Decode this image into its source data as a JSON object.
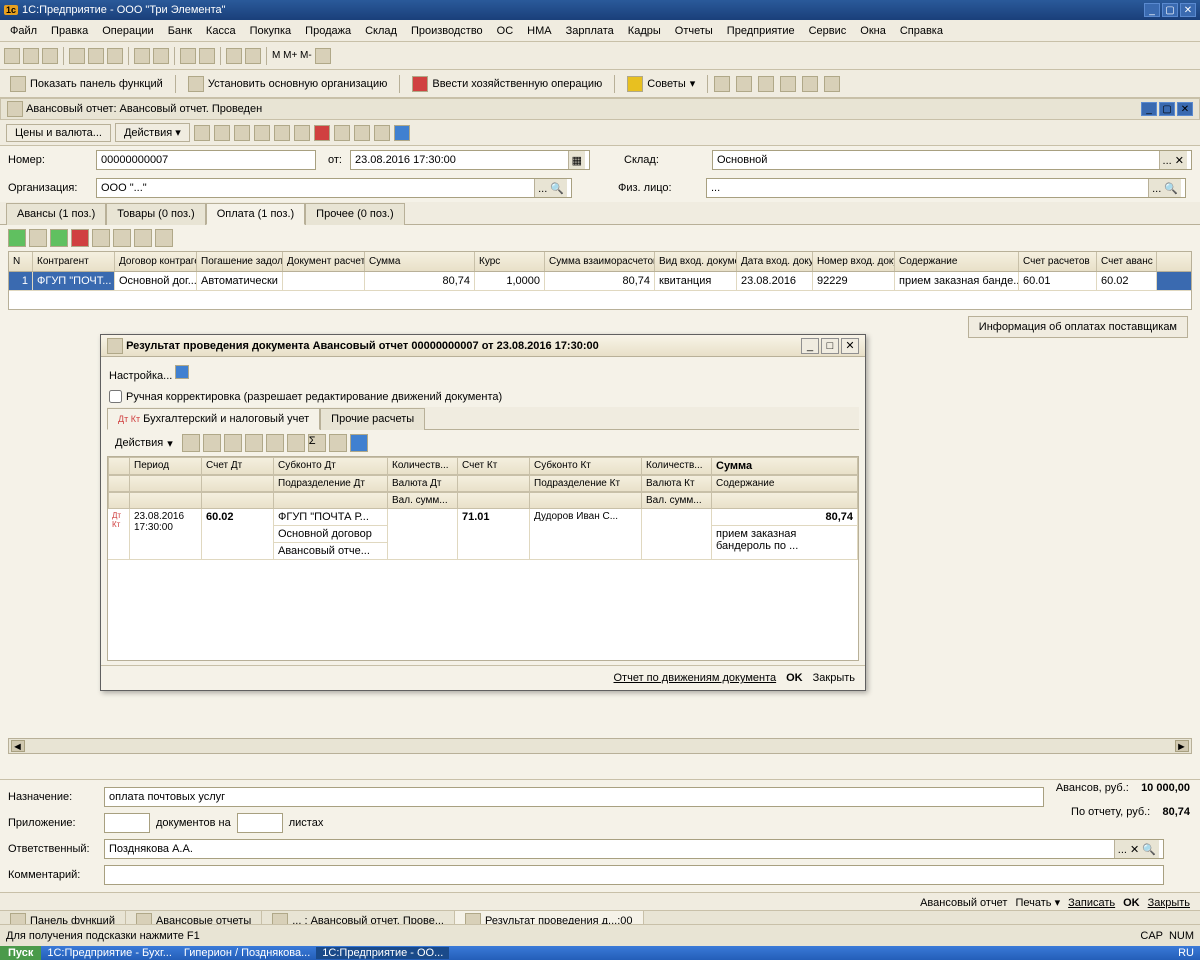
{
  "app": {
    "title": "1С:Предприятие - ООО \"Три Элемента\""
  },
  "menu": [
    "Файл",
    "Правка",
    "Операции",
    "Банк",
    "Касса",
    "Покупка",
    "Продажа",
    "Склад",
    "Производство",
    "ОС",
    "НМА",
    "Зарплата",
    "Кадры",
    "Отчеты",
    "Предприятие",
    "Сервис",
    "Окна",
    "Справка"
  ],
  "toolbar2": {
    "show_panel": "Показать панель функций",
    "set_org": "Установить основную организацию",
    "enter_op": "Ввести хозяйственную операцию",
    "advice": "Советы"
  },
  "doc": {
    "title": "Авансовый отчет: Авансовый отчет. Проведен",
    "prices_currency": "Цены и валюта...",
    "actions": "Действия",
    "number_label": "Номер:",
    "number": "00000000007",
    "from_label": "от:",
    "date": "23.08.2016 17:30:00",
    "warehouse_label": "Склад:",
    "warehouse": "Основной",
    "org_label": "Организация:",
    "org": "ООО \"...\"",
    "fiz_label": "Физ. лицо:",
    "fiz": "...",
    "tabs": [
      "Авансы (1 поз.)",
      "Товары (0 поз.)",
      "Оплата (1 поз.)",
      "Прочее (0 поз.)"
    ],
    "activeTab": 2,
    "grid_headers": [
      "N",
      "Контрагент",
      "Договор контрагента",
      "Погашение задолженности",
      "Документ расчетов",
      "Сумма",
      "Курс",
      "Сумма взаиморасчетов",
      "Вид вход. документа",
      "Дата вход. документа",
      "Номер вход. документа",
      "Содержание",
      "Счет расчетов",
      "Счет аванс"
    ],
    "grid_row": {
      "n": "1",
      "contragent": "ФГУП \"ПОЧТ...",
      "contract": "Основной дог...",
      "pogash": "Автоматически",
      "docr": "",
      "sum": "80,74",
      "rate": "1,0000",
      "sumvz": "80,74",
      "vid": "квитанция",
      "din": "23.08.2016",
      "nin": "92229",
      "cont": "прием заказная банде...",
      "acc": "60.01",
      "accav": "60.02"
    },
    "info_btn": "Информация об оплатах поставщикам"
  },
  "dialog": {
    "title": "Результат проведения документа Авансовый отчет 00000000007 от 23.08.2016 17:30:00",
    "settings": "Настройка...",
    "manual_edit": "Ручная корректировка (разрешает редактирование движений документа)",
    "tabs": [
      "Бухгалтерский и налоговый учет",
      "Прочие расчеты"
    ],
    "actions": "Действия",
    "headers1": [
      "",
      "Период",
      "Счет Дт",
      "Субконто Дт",
      "Количеств...",
      "Счет Кт",
      "Субконто Кт",
      "Количеств...",
      "Сумма"
    ],
    "headers2": [
      "",
      "",
      "",
      "Подразделение Дт",
      "Валюта Дт",
      "",
      "Подразделение Кт",
      "Валюта Кт",
      "Содержание"
    ],
    "headers3": [
      "",
      "",
      "",
      "",
      "Вал. сумм...",
      "",
      "",
      "Вал. сумм...",
      ""
    ],
    "row": {
      "period": "23.08.2016 17:30:00",
      "dt": "60.02",
      "subdt": "ФГУП \"ПОЧТА Р...",
      "subdt2": "Основной договор",
      "subdt3": "Авансовый отче...",
      "kt": "71.01",
      "subkt": "Дудоров  Иван С...",
      "sum": "80,74",
      "cont": "прием заказная бандероль по ..."
    },
    "report_link": "Отчет по движениям документа",
    "ok": "OK",
    "close": "Закрыть"
  },
  "footer": {
    "назначение_label": "Назначение:",
    "назначение": "оплата почтовых услуг",
    "приложение_label": "Приложение:",
    "приложение_doc": "документов на",
    "приложение_sheets": "листах",
    "ответственный_label": "Ответственный:",
    "ответственный": "Позднякова А.А.",
    "комментарий_label": "Комментарий:",
    "avans_label": "Авансов, руб.:",
    "avans": "10 000,00",
    "po_otchetu_label": "По отчету, руб.:",
    "po_otchetu": "80,74"
  },
  "docbar": {
    "report": "Авансовый отчет",
    "print": "Печать",
    "save": "Записать",
    "ok": "OK",
    "close": "Закрыть"
  },
  "winbar": [
    "Панель функций",
    "Авансовые отчеты",
    "... : Авансовый отчет. Прове...",
    "Результат проведения д...:00"
  ],
  "statusbar": {
    "hint": "Для получения подсказки нажмите F1",
    "lang": "RU",
    "cap": "CAP",
    "num": "NUM"
  },
  "taskbar": {
    "start": "Пуск",
    "items": [
      "1С:Предприятие - Бухг...",
      "Гиперион / Позднякова...",
      "1С:Предприятие - ОО..."
    ]
  }
}
